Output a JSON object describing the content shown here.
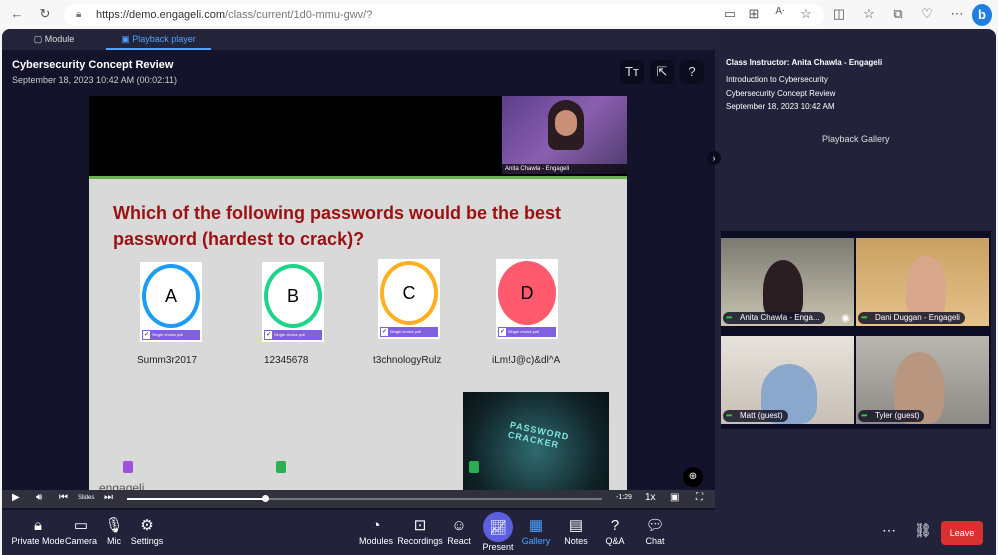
{
  "browser": {
    "url_host": "https://demo.engageli.com",
    "url_path": "/class/current/1d0-mmu-gwv/?"
  },
  "tabs": [
    {
      "label": "Module"
    },
    {
      "label": "Playback player",
      "active": true
    }
  ],
  "header": {
    "title": "Cybersecurity Concept Review",
    "subtitle": "September 18, 2023 10:42 AM (00:02:11)"
  },
  "slide": {
    "instructor_label": "Anita Chawla - Engageli",
    "question": "Which of the following passwords would be the best password (hardest to crack)?",
    "options": [
      {
        "letter": "A",
        "text": "Summ3r2017",
        "color": "#1e9bf5",
        "poll": "Single choice poll"
      },
      {
        "letter": "B",
        "text": "12345678",
        "color": "#1ed48a",
        "poll": "Single choice poll"
      },
      {
        "letter": "C",
        "text": "t3chnologyRulz",
        "color": "#ffb020",
        "poll": "Single choice poll"
      },
      {
        "letter": "D",
        "text": "iLm!J@c)&dl^A",
        "color": "#ff5a6e",
        "poll": "Single choice poll",
        "filled": true
      }
    ],
    "image_text": "PASSWORD CRACKER",
    "logo": "engageli"
  },
  "player": {
    "slides_label": "Slides",
    "time_remaining": "-1:29",
    "speed": "1x",
    "progress": 0.29
  },
  "right": {
    "instructor": "Class Instructor: Anita Chawla - Engageli",
    "course": "Introduction to Cybersecurity",
    "session": "Cybersecurity Concept Review",
    "date": "September 18, 2023 10:42 AM",
    "gallery_title": "Playback Gallery",
    "participants": [
      {
        "name": "Anita Chawla - Enga..."
      },
      {
        "name": "Dani Duggan - Engageli"
      },
      {
        "name": "Matt (guest)"
      },
      {
        "name": "Tyler (guest)"
      }
    ]
  },
  "toolbar": {
    "left": [
      {
        "label": "Private Mode",
        "icon": "lock-icon"
      },
      {
        "label": "Camera",
        "icon": "camera-icon"
      },
      {
        "label": "Mic",
        "icon": "mic-icon"
      },
      {
        "label": "Settings",
        "icon": "gear-icon"
      }
    ],
    "center": [
      {
        "label": "Modules"
      },
      {
        "label": "Recordings"
      },
      {
        "label": "React"
      },
      {
        "label": "Present"
      },
      {
        "label": "Gallery",
        "active": true
      },
      {
        "label": "Notes"
      },
      {
        "label": "Q&A"
      },
      {
        "label": "Chat"
      }
    ],
    "leave": "Leave",
    "accent": "#4da3ff",
    "leave_color": "#d93030"
  }
}
